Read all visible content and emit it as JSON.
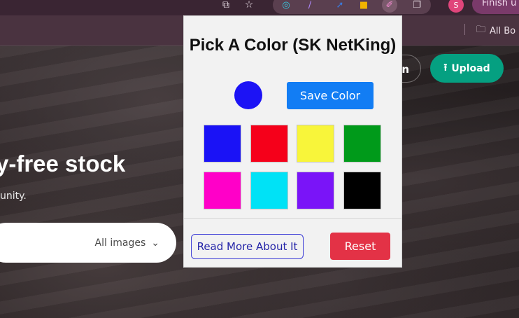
{
  "browser": {
    "finish_label": "Finish u",
    "profile_initial": "S",
    "bookmark_label": "All Bo"
  },
  "site": {
    "login_label": "n",
    "upload_label": "Upload",
    "hero_title": "y-free stock",
    "hero_subtitle": "unity.",
    "search_filter_label": "All images"
  },
  "popup": {
    "title": "Pick A Color (SK NetKing)",
    "selected_color": "#1c13f5",
    "save_label": "Save Color",
    "swatches": [
      "#1a12f6",
      "#f5001a",
      "#f8f53a",
      "#009a1a",
      "#ff00c8",
      "#00e2f6",
      "#7a14f8",
      "#000000"
    ],
    "read_more_label": "Read More About It",
    "reset_label": "Reset"
  },
  "colors": {
    "upload_green": "#05a081",
    "save_blue": "#127df4",
    "reset_red": "#e33246"
  }
}
